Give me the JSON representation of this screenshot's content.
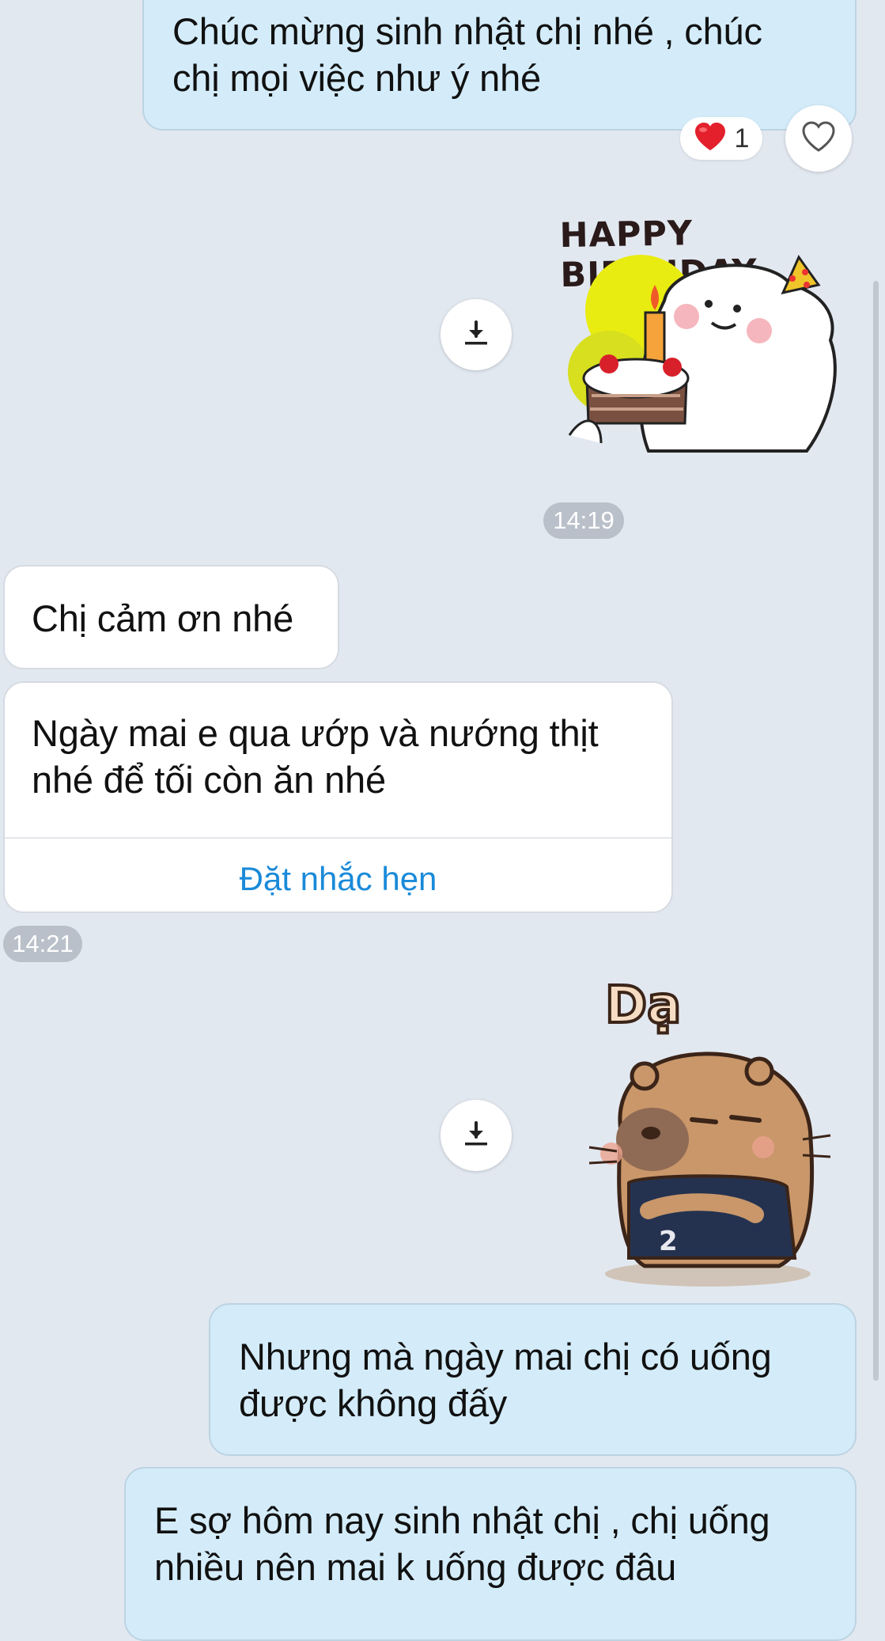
{
  "messages": {
    "m1": {
      "text": "Chúc mừng sinh nhật chị nhé , chúc\nchị mọi việc như ý nhé",
      "reaction_count": "1"
    },
    "sticker1": {
      "caption": "HAPPY BIRTHDAY"
    },
    "time1": "14:19",
    "m2": {
      "text": "Chị cảm ơn nhé"
    },
    "m3": {
      "text": "Ngày mai e qua ướp và nướng thịt\nnhé để tối còn ăn nhé",
      "action_label": "Đặt nhắc hẹn"
    },
    "time2": "14:21",
    "sticker2": {
      "caption": "Dạ"
    },
    "m4": {
      "text": "Nhưng mà ngày mai chị có uống\nđược không đấy"
    },
    "m5": {
      "text": "E sợ hôm nay sinh nhật chị , chị uống\nnhiều nên mai k uống được đâu"
    }
  },
  "icons": {
    "reaction": "red-heart-icon",
    "react_button": "heart-outline-icon",
    "download": "download-icon"
  },
  "colors": {
    "background": "#e2e8f0",
    "outgoing_bubble": "#d4ecfa",
    "incoming_bubble": "#ffffff",
    "link": "#1a8ad9",
    "time_pill": "#b9c0c9"
  }
}
